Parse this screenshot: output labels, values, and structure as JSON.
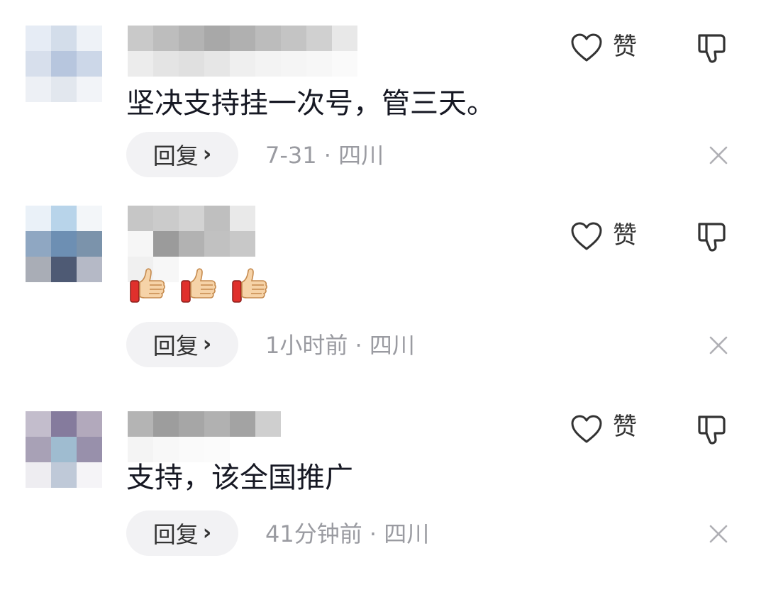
{
  "comments": [
    {
      "text": "坚决支持挂一次号，管三天。",
      "reply_label": "回复",
      "meta": "7-31 · 四川",
      "like_label": "赞",
      "avatar_colors": [
        "#e6ecf5",
        "#d3ddea",
        "#eef2f7",
        "#d7dfec",
        "#b7c6de",
        "#ccd7e8",
        "#edf0f5",
        "#e2e7ee",
        "#f2f4f8"
      ],
      "nick_colors": [
        "#c9c9c9",
        "#bdbdbd",
        "#b3b3b3",
        "#a8a8a8",
        "#b0b0b0",
        "#bcbcbc",
        "#c4c4c4",
        "#d0d0d0",
        "#e8e8e8",
        "#ececec",
        "#e4e4e4",
        "#e0e0e0",
        "#e6e6e6",
        "#efefef",
        "#f3f3f3",
        "#f5f5f5",
        "#f7f7f7",
        "#fafafa"
      ]
    },
    {
      "text": "",
      "emoji": [
        "thumbs-up",
        "thumbs-up",
        "thumbs-up"
      ],
      "reply_label": "回复",
      "meta": "1小时前 · 四川",
      "like_label": "赞",
      "avatar_colors": [
        "#eaf1f8",
        "#b8d4ea",
        "#f3f6f9",
        "#8fa7c2",
        "#6d8fb3",
        "#7b93ab",
        "#a9adb6",
        "#4e5a74",
        "#b5b9c6"
      ],
      "nick_colors": [
        "#c6c6c6",
        "#cbcbcb",
        "#d3d3d3",
        "#bfbfbf",
        "#e9e9e9",
        "#f6f6f6",
        "#9b9b9b",
        "#b2b2b2",
        "#c1c1c1",
        "#c8c8c8",
        "#f0f0f0",
        "#f7f7f7"
      ]
    },
    {
      "text": "支持，该全国推广",
      "reply_label": "回复",
      "meta": "41分钟前 · 四川",
      "like_label": "赞",
      "avatar_colors": [
        "#c3bdcc",
        "#857b9d",
        "#b2a9bc",
        "#a8a1b6",
        "#9fbcd0",
        "#9890ab",
        "#eeedf1",
        "#bfc9d8",
        "#f5f4f7"
      ],
      "nick_colors": [
        "#b4b4b4",
        "#9d9d9d",
        "#a6a6a6",
        "#b1b1b1",
        "#a3a3a3",
        "#cfcfcf",
        "#f4f4f4",
        "#f8f8f8",
        "#fafafa",
        "#fbfbfb"
      ]
    }
  ]
}
